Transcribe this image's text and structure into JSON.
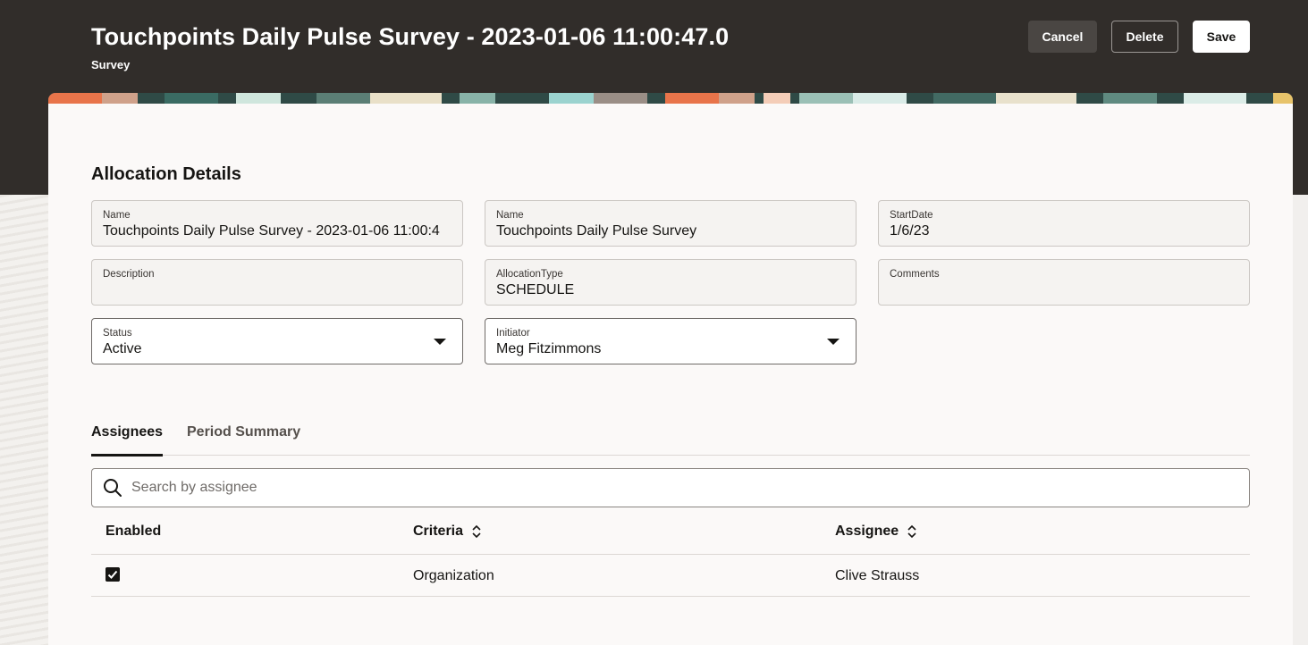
{
  "header": {
    "title": "Touchpoints Daily Pulse Survey - 2023-01-06 11:00:47.0",
    "subtitle": "Survey",
    "buttons": {
      "cancel": "Cancel",
      "delete": "Delete",
      "save": "Save"
    }
  },
  "section": {
    "title": "Allocation Details"
  },
  "fields": {
    "name1": {
      "label": "Name",
      "value": "Touchpoints Daily Pulse Survey - 2023-01-06 11:00:4"
    },
    "name2": {
      "label": "Name",
      "value": "Touchpoints Daily Pulse Survey"
    },
    "start_date": {
      "label": "StartDate",
      "value": "1/6/23"
    },
    "description": {
      "label": "Description",
      "value": ""
    },
    "allocation_type": {
      "label": "AllocationType",
      "value": "SCHEDULE"
    },
    "comments": {
      "label": "Comments",
      "value": ""
    },
    "status": {
      "label": "Status",
      "value": "Active"
    },
    "initiator": {
      "label": "Initiator",
      "value": "Meg Fitzimmons"
    }
  },
  "tabs": [
    {
      "label": "Assignees",
      "active": true
    },
    {
      "label": "Period Summary",
      "active": false
    }
  ],
  "search": {
    "placeholder": "Search by assignee",
    "value": ""
  },
  "table": {
    "columns": [
      "Enabled",
      "Criteria",
      "Assignee"
    ],
    "rows": [
      {
        "enabled": true,
        "criteria": "Organization",
        "assignee": "Clive Strauss"
      }
    ]
  },
  "colors": {
    "header_bg": "#312d2a",
    "card_bg": "#fbf9f8",
    "accent_dark": "#161513"
  },
  "icons": {
    "search": "search-icon",
    "sort": "sort-icon",
    "caret": "chevron-down-icon",
    "checkbox": "checkbox-checked-icon"
  }
}
